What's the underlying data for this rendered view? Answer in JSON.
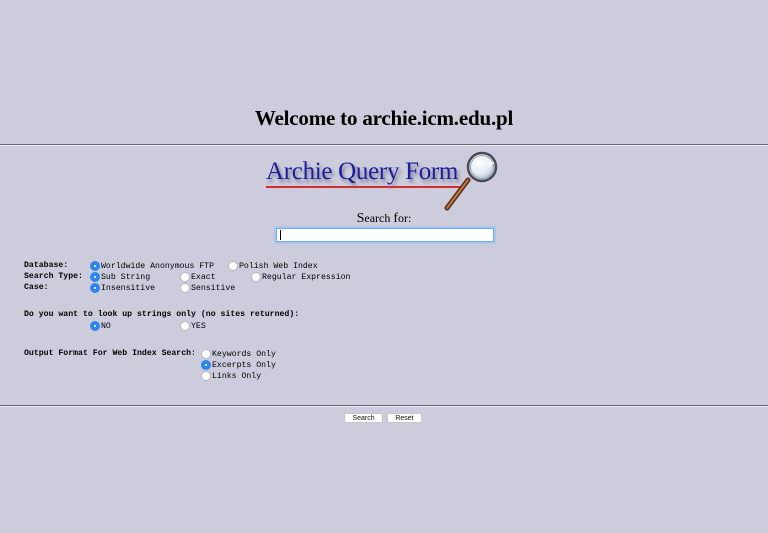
{
  "header": {
    "welcome": "Welcome to archie.icm.edu.pl"
  },
  "logo": {
    "title": "Archie Query Form",
    "icon": "magnifying-glass-icon"
  },
  "search": {
    "label_first": "S",
    "label_rest": "earch ",
    "label_f": "f",
    "label_end": "or:",
    "value": "",
    "placeholder": ""
  },
  "options": {
    "database": {
      "label": "Database:",
      "choices": [
        {
          "label": "Worldwide Anonymous FTP",
          "selected": true
        },
        {
          "label": "Polish Web Index",
          "selected": false
        }
      ]
    },
    "search_type": {
      "label": "Search Type:",
      "choices": [
        {
          "label": "Sub String",
          "selected": true
        },
        {
          "label": "Exact",
          "selected": false
        },
        {
          "label": "Regular Expression",
          "selected": false
        }
      ]
    },
    "case": {
      "label": "Case:",
      "choices": [
        {
          "label": "Insensitive",
          "selected": true
        },
        {
          "label": "Sensitive",
          "selected": false
        }
      ]
    },
    "strings_only": {
      "label": "Do you want to look up strings only (no sites returned):",
      "choices": [
        {
          "label": "NO",
          "selected": true
        },
        {
          "label": "YES",
          "selected": false
        }
      ]
    },
    "output_format": {
      "label": "Output Format For Web Index Search:",
      "choices": [
        {
          "label": "Keywords Only",
          "selected": false
        },
        {
          "label": "Excerpts Only",
          "selected": true
        },
        {
          "label": "Links Only",
          "selected": false
        }
      ]
    }
  },
  "buttons": {
    "search": "Search",
    "reset": "Reset"
  },
  "colors": {
    "background": "#ccccdd",
    "radio_selected": "#2f86ea",
    "logo_text": "#1c1ca0",
    "logo_underline": "#d03030"
  }
}
